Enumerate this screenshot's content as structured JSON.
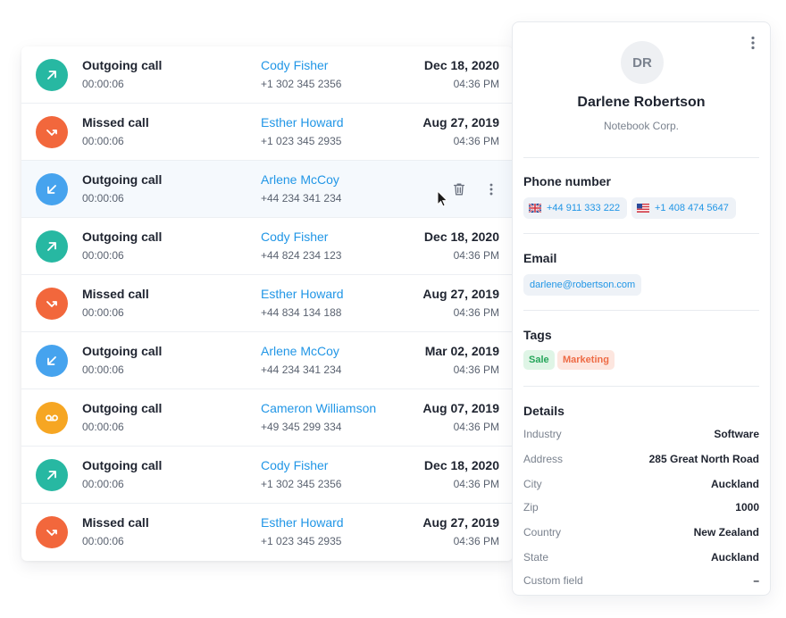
{
  "colors": {
    "outgoing_green": "#27b8a2",
    "missed_orange": "#f2673c",
    "incoming_blue": "#46a3ee",
    "voicemail_yellow": "#f6a623",
    "link_blue": "#2196e6"
  },
  "calls": [
    {
      "type": "Outgoing call",
      "duration": "00:00:06",
      "name": "Cody Fisher",
      "number": "+1 302 345 2356",
      "date": "Dec 18, 2020",
      "time": "04:36 PM",
      "icon": "arrow-up-right-icon"
    },
    {
      "type": "Missed call",
      "duration": "00:00:06",
      "name": "Esther Howard",
      "number": "+1 023 345 2935",
      "date": "Aug 27, 2019",
      "time": "04:36 PM",
      "icon": "missed-call-icon"
    },
    {
      "type": "Outgoing call",
      "duration": "00:00:06",
      "name": "Arlene McCoy",
      "number": "+44 234 341 234",
      "date": "",
      "time": "",
      "icon": "arrow-down-left-icon",
      "selected": true
    },
    {
      "type": "Outgoing call",
      "duration": "00:00:06",
      "name": "Cody Fisher",
      "number": "+44 824 234 123",
      "date": "Dec 18, 2020",
      "time": "04:36 PM",
      "icon": "arrow-up-right-icon"
    },
    {
      "type": "Missed call",
      "duration": "00:00:06",
      "name": "Esther Howard",
      "number": "+44 834 134 188",
      "date": "Aug 27, 2019",
      "time": "04:36 PM",
      "icon": "missed-call-icon"
    },
    {
      "type": "Outgoing call",
      "duration": "00:00:06",
      "name": "Arlene McCoy",
      "number": "+44 234 341 234",
      "date": "Mar 02, 2019",
      "time": "04:36 PM",
      "icon": "arrow-down-left-icon"
    },
    {
      "type": "Outgoing call",
      "duration": "00:00:06",
      "name": "Cameron Williamson",
      "number": "+49 345 299 334",
      "date": "Aug 07, 2019",
      "time": "04:36 PM",
      "icon": "voicemail-icon"
    },
    {
      "type": "Outgoing call",
      "duration": "00:00:06",
      "name": "Cody Fisher",
      "number": "+1 302 345 2356",
      "date": "Dec 18, 2020",
      "time": "04:36 PM",
      "icon": "arrow-up-right-icon"
    },
    {
      "type": "Missed call",
      "duration": "00:00:06",
      "name": "Esther Howard",
      "number": "+1 023 345 2935",
      "date": "Aug 27, 2019",
      "time": "04:36 PM",
      "icon": "missed-call-icon"
    }
  ],
  "contact": {
    "initials": "DR",
    "name": "Darlene Robertson",
    "company": "Notebook Corp.",
    "phone_title": "Phone number",
    "phones": [
      {
        "flag": "uk-flag-icon",
        "number": "+44 911 333 222"
      },
      {
        "flag": "us-flag-icon",
        "number": "+1 408 474 5647"
      }
    ],
    "email_title": "Email",
    "email": "darlene@robertson.com",
    "tags_title": "Tags",
    "tags": [
      "Sale",
      "Marketing"
    ],
    "details_title": "Details",
    "details": [
      {
        "label": "Industry",
        "value": "Software"
      },
      {
        "label": "Address",
        "value": "285 Great North Road"
      },
      {
        "label": "City",
        "value": "Auckland"
      },
      {
        "label": "Zip",
        "value": "1000"
      },
      {
        "label": "Country",
        "value": "New Zealand"
      },
      {
        "label": "State",
        "value": "Auckland"
      },
      {
        "label": "Custom field",
        "value": "–"
      }
    ]
  }
}
